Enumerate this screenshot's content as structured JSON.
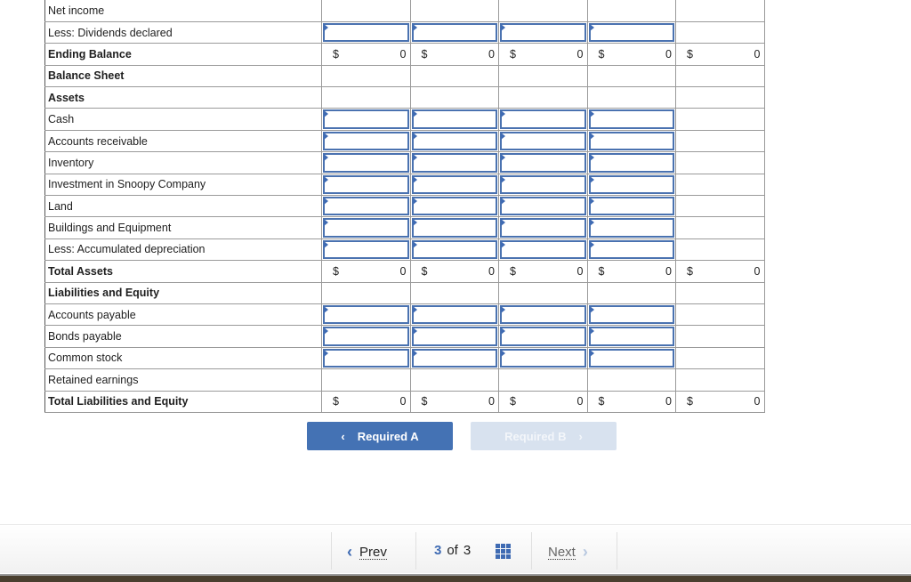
{
  "worksheet": {
    "columns": 5,
    "rows": [
      {
        "label": "Net income",
        "bold": false,
        "type": "blank-top"
      },
      {
        "label": "Less: Dividends declared",
        "bold": false,
        "type": "input",
        "inputs": 4
      },
      {
        "label": "Ending Balance",
        "bold": true,
        "type": "total",
        "values": [
          "0",
          "0",
          "0",
          "0",
          "0"
        ]
      },
      {
        "label": "Balance Sheet",
        "bold": true,
        "type": "blank"
      },
      {
        "label": "Assets",
        "bold": true,
        "type": "blank"
      },
      {
        "label": "Cash",
        "bold": false,
        "type": "input",
        "inputs": 4
      },
      {
        "label": "Accounts receivable",
        "bold": false,
        "type": "input",
        "inputs": 4
      },
      {
        "label": "Inventory",
        "bold": false,
        "type": "input",
        "inputs": 4
      },
      {
        "label": "Investment in Snoopy Company",
        "bold": false,
        "type": "input",
        "inputs": 4
      },
      {
        "label": "Land",
        "bold": false,
        "type": "input",
        "inputs": 4
      },
      {
        "label": "Buildings and Equipment",
        "bold": false,
        "type": "input",
        "inputs": 4
      },
      {
        "label": "Less: Accumulated depreciation",
        "bold": false,
        "type": "input",
        "inputs": 4
      },
      {
        "label": "Total Assets",
        "bold": true,
        "type": "total",
        "values": [
          "0",
          "0",
          "0",
          "0",
          "0"
        ]
      },
      {
        "label": "Liabilities and Equity",
        "bold": true,
        "type": "blank"
      },
      {
        "label": "Accounts payable",
        "bold": false,
        "type": "input",
        "inputs": 4
      },
      {
        "label": "Bonds payable",
        "bold": false,
        "type": "input",
        "inputs": 4
      },
      {
        "label": "Common stock",
        "bold": false,
        "type": "input",
        "inputs": 4
      },
      {
        "label": "Retained earnings",
        "bold": false,
        "type": "blank"
      },
      {
        "label": "Total Liabilities and Equity",
        "bold": true,
        "type": "total",
        "values": [
          "0",
          "0",
          "0",
          "0",
          "0"
        ]
      }
    ],
    "currency_symbol": "$"
  },
  "nav_buttons": {
    "prev_label": "Required A",
    "next_label": "Required B",
    "prev_icon": "chevron-left-icon",
    "next_icon": "chevron-right-icon"
  },
  "pager": {
    "prev_label": "Prev",
    "current": "3",
    "of_label": "of",
    "total": "3",
    "next_label": "Next"
  },
  "colors": {
    "accent": "#4472b4",
    "disabled_button": "#d8e2ef"
  }
}
